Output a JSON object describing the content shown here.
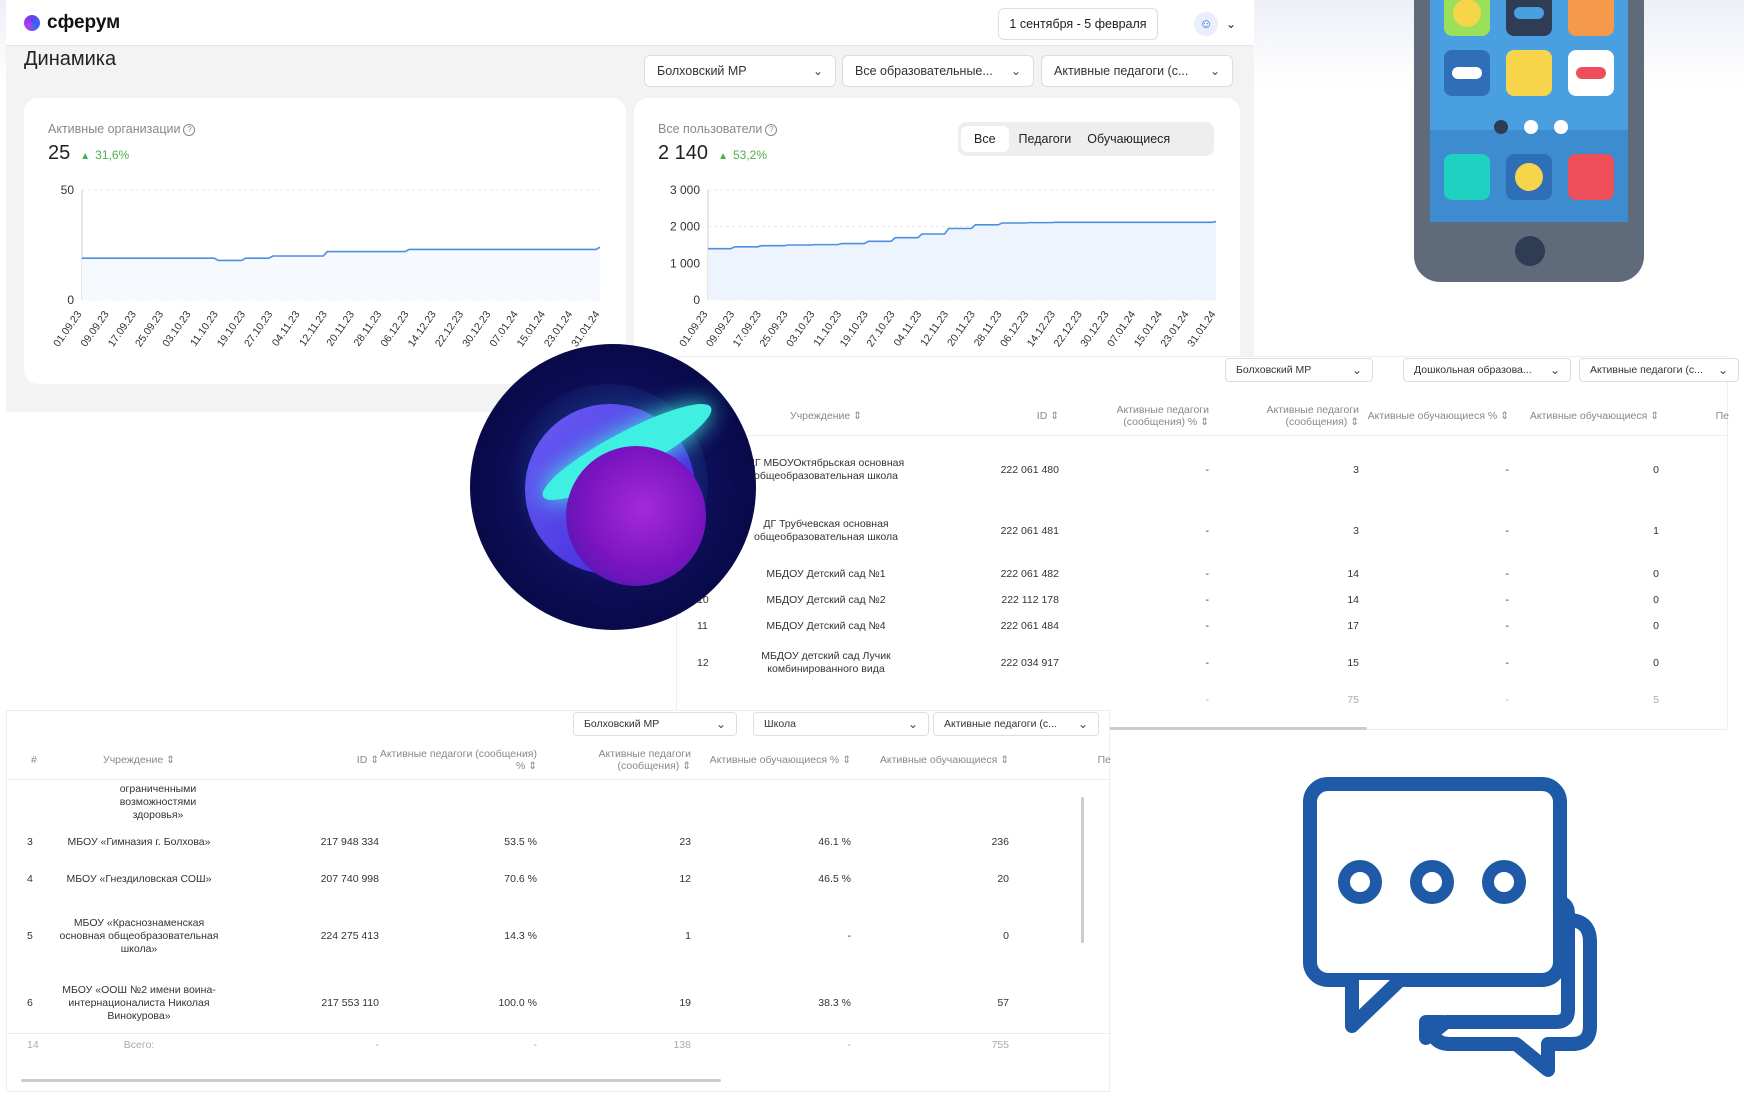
{
  "header": {
    "brand": "сферум",
    "date_range": "1 сентября - 5 февраля"
  },
  "dynamics": {
    "title": "Динамика",
    "filters": [
      "Болховский МР",
      "Все образовательные...",
      "Активные педагоги (с..."
    ],
    "orgs_card": {
      "label": "Активные организации",
      "value": "25",
      "delta": "31,6%"
    },
    "users_card": {
      "label": "Все пользователи",
      "value": "2 140",
      "delta": "53,2%",
      "tabs": [
        "Все",
        "Педагоги",
        "Обучающиеся"
      ],
      "active_tab": "Все"
    }
  },
  "chart_data": [
    {
      "type": "line",
      "title": "Активные организации",
      "x": [
        "01.09.23",
        "09.09.23",
        "17.09.23",
        "25.09.23",
        "03.10.23",
        "11.10.23",
        "19.10.23",
        "27.10.23",
        "04.11.23",
        "12.11.23",
        "20.11.23",
        "28.11.23",
        "06.12.23",
        "14.12.23",
        "22.12.23",
        "30.12.23",
        "07.01.24",
        "15.01.24",
        "23.01.24",
        "31.01.24"
      ],
      "y_ticks": [
        "50",
        "0"
      ],
      "ylim": [
        0,
        50
      ],
      "values": [
        19,
        19,
        19,
        19,
        19,
        18,
        19,
        20,
        20,
        22,
        22,
        22,
        23,
        23,
        23,
        23,
        23,
        23,
        23,
        24
      ],
      "grid": true
    },
    {
      "type": "area",
      "title": "Все пользователи",
      "x": [
        "01.09.23",
        "09.09.23",
        "17.09.23",
        "25.09.23",
        "03.10.23",
        "11.10.23",
        "19.10.23",
        "27.10.23",
        "04.11.23",
        "12.11.23",
        "20.11.23",
        "28.11.23",
        "06.12.23",
        "14.12.23",
        "22.12.23",
        "30.12.23",
        "07.01.24",
        "15.01.24",
        "23.01.24",
        "31.01.24"
      ],
      "y_ticks": [
        "3 000",
        "2 000",
        "1 000",
        "0"
      ],
      "ylim": [
        0,
        3000
      ],
      "values": [
        1400,
        1450,
        1480,
        1500,
        1510,
        1540,
        1600,
        1700,
        1800,
        1950,
        2050,
        2100,
        2110,
        2120,
        2120,
        2120,
        2120,
        2120,
        2120,
        2140
      ],
      "grid": true
    }
  ],
  "preschool": {
    "filters": [
      "Болховский МР",
      "Дошкольная образова...",
      "Активные педагоги (с..."
    ],
    "columns": [
      "Учреждение",
      "ID",
      "Активные педагоги (сообщения) %",
      "Активные педагоги (сообщения)",
      "Активные обучающиеся %",
      "Активные обучающиеся",
      "Пе"
    ],
    "rows": [
      {
        "num": "",
        "name": "ДГ МБОУОктябрьская основная общеобразовательная школа",
        "id": "222 061 480",
        "tp": "-",
        "t": "3",
        "sp": "-",
        "s": "0"
      },
      {
        "num": "",
        "name": "ДГ Трубчевская основная общеобразовательная школа",
        "id": "222 061 481",
        "tp": "-",
        "t": "3",
        "sp": "-",
        "s": "1"
      },
      {
        "num": "",
        "name": "МБДОУ Детский сад №1",
        "id": "222 061 482",
        "tp": "-",
        "t": "14",
        "sp": "-",
        "s": "0"
      },
      {
        "num": "10",
        "name": "МБДОУ Детский сад №2",
        "id": "222 112 178",
        "tp": "-",
        "t": "14",
        "sp": "-",
        "s": "0"
      },
      {
        "num": "11",
        "name": "МБДОУ Детский сад №4",
        "id": "222 061 484",
        "tp": "-",
        "t": "17",
        "sp": "-",
        "s": "0"
      },
      {
        "num": "12",
        "name": "МБДОУ детский сад Лучик комбинированного вида",
        "id": "222 034 917",
        "tp": "-",
        "t": "15",
        "sp": "-",
        "s": "0"
      }
    ],
    "total": {
      "t": "75",
      "s": "5"
    }
  },
  "school": {
    "filters": [
      "Болховский МР",
      "Школа",
      "Активные педагоги (с..."
    ],
    "columns": [
      "#",
      "Учреждение",
      "ID",
      "Активные педагоги (сообщения) %",
      "Активные педагоги (сообщения)",
      "Активные обучающиеся %",
      "Активные обучающиеся",
      "Пе"
    ],
    "cut_row": "ограниченными возможностями здоровья»",
    "rows": [
      {
        "num": "3",
        "name": "МБОУ «Гимназия г. Болхова»",
        "id": "217 948 334",
        "tp": "53.5 %",
        "t": "23",
        "sp": "46.1 %",
        "s": "236"
      },
      {
        "num": "4",
        "name": "МБОУ «Гнездиловская СОШ»",
        "id": "207 740 998",
        "tp": "70.6 %",
        "t": "12",
        "sp": "46.5 %",
        "s": "20"
      },
      {
        "num": "5",
        "name": "МБОУ «Краснознаменская основная общеобразовательная школа»",
        "id": "224 275 413",
        "tp": "14.3 %",
        "t": "1",
        "sp": "-",
        "s": "0"
      },
      {
        "num": "6",
        "name": "МБОУ «ООШ №2 имени воина-интернационалиста Николая Винокурова»",
        "id": "217 553 110",
        "tp": "100.0 %",
        "t": "19",
        "sp": "38.3 %",
        "s": "57"
      }
    ],
    "total": {
      "num": "14",
      "name": "Всего:",
      "id": "-",
      "tp": "-",
      "t": "138",
      "sp": "-",
      "s": "755"
    }
  },
  "colors": {
    "accent_blue": "#4a90e2",
    "positive_green": "#4caf50",
    "phone_body": "#5f6b7a",
    "chat_icon": "#1f5aa8",
    "sphere_bg": "#05063a"
  }
}
